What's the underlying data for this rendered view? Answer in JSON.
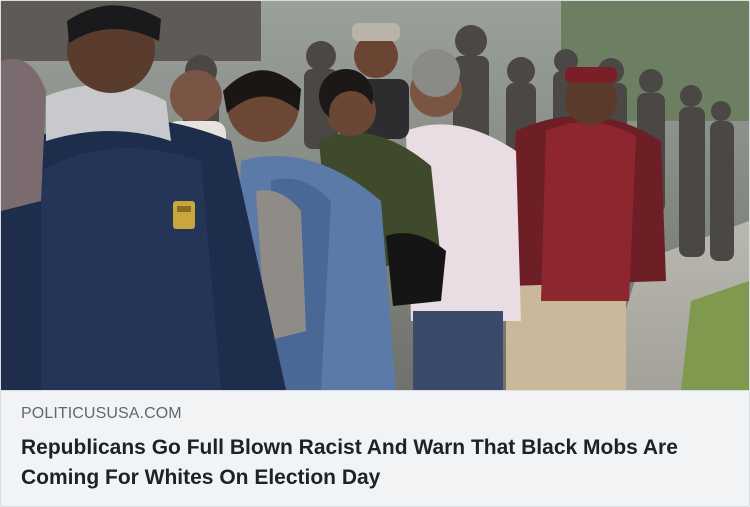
{
  "link_preview": {
    "image": {
      "alt": ""
    },
    "domain": "POLITICUSUSA.COM",
    "headline": "Republicans Go Full Blown Racist And Warn That Black Mobs Are Coming For Whites On Election Day"
  },
  "colors": {
    "caption_background": "#f2f3f5",
    "domain_text": "#606770",
    "headline_text": "#1d2129",
    "border": "#dadde1"
  }
}
